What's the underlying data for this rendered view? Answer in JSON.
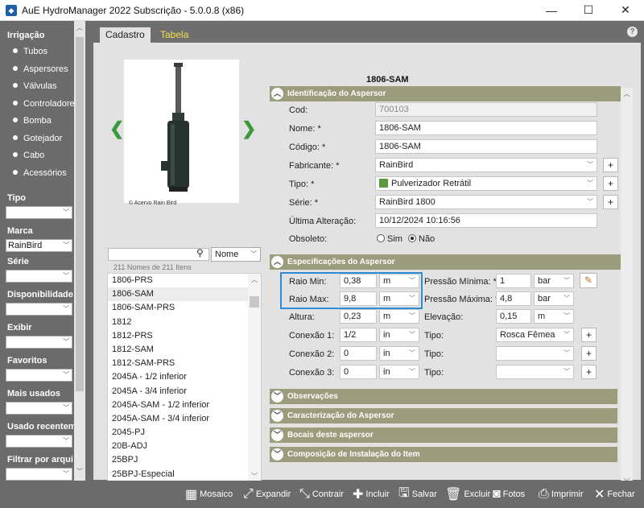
{
  "window": {
    "title": "AuE HydroManager 2022 Subscrição - 5.0.0.8 (x86)",
    "minimize": "—",
    "maximize": "☐",
    "close": "✕"
  },
  "sidebar": {
    "sections": [
      {
        "label": "Irrigação"
      },
      {
        "label": "Tipo",
        "value": ""
      },
      {
        "label": "Marca",
        "value": "RainBird"
      },
      {
        "label": "Série",
        "value": ""
      },
      {
        "label": "Disponibilidade",
        "value": ""
      },
      {
        "label": "Exibir",
        "value": ""
      },
      {
        "label": "Favoritos",
        "value": ""
      },
      {
        "label": "Mais usados",
        "value": ""
      },
      {
        "label": "Usado recentem",
        "value": ""
      },
      {
        "label": "Filtrar por arqui",
        "value": ""
      }
    ],
    "items": [
      "Tubos",
      "Aspersores",
      "Válvulas",
      "Controladores",
      "Bomba",
      "Gotejador",
      "Cabo",
      "Acessórios"
    ],
    "selected_item": "Aspersores"
  },
  "tabs": [
    {
      "label": "Cadastro",
      "active": true
    },
    {
      "label": "Tabela",
      "active": false
    }
  ],
  "photo": {
    "credit": "© Acervo Rain Bird"
  },
  "list": {
    "search_value": "",
    "order": "Nome",
    "count_text": "211 Nomes de 211 Itens",
    "items": [
      "1806-PRS",
      "1806-SAM",
      "1806-SAM-PRS",
      "1812",
      "1812-PRS",
      "1812-SAM",
      "1812-SAM-PRS",
      "2045A - 1/2 inferior",
      "2045A - 3/4 inferior",
      "2045A-SAM - 1/2 inferior",
      "2045A-SAM - 3/4 inferior",
      "2045-PJ",
      "20B-ADJ",
      "25BPJ",
      "25BPJ-Especial"
    ],
    "selected": "1806-SAM"
  },
  "form": {
    "title": "1806-SAM",
    "identificacao": {
      "header": "Identificação do Aspersor",
      "cod_label": "Cod:",
      "cod": "700103",
      "nome_label": "Nome: *",
      "nome": "1806-SAM",
      "codigo_label": "Código: *",
      "codigo": "1806-SAM",
      "fabricante_label": "Fabricante: *",
      "fabricante": "RainBird",
      "tipo_label": "Tipo: *",
      "tipo": "Pulverizador Retrátil",
      "serie_label": "Série: *",
      "serie": "RainBird 1800",
      "alteracao_label": "Última Alteração:",
      "alteracao": "10/12/2024 10:16:56",
      "obsoleto_label": "Obsoleto:",
      "sim": "Sim",
      "nao": "Não",
      "obsoleto_value": "Não"
    },
    "especificacoes": {
      "header": "Especificações do Aspersor",
      "raio_min_label": "Raio Min:",
      "raio_min": "0,38",
      "raio_min_unit": "m",
      "raio_max_label": "Raio Max:",
      "raio_max": "9,8",
      "raio_max_unit": "m",
      "altura_label": "Altura:",
      "altura": "0,23",
      "altura_unit": "m",
      "conexao1_label": "Conexão 1:",
      "conexao1": "1/2",
      "conexao1_unit": "in",
      "conexao2_label": "Conexão 2:",
      "conexao2": "0",
      "conexao2_unit": "in",
      "conexao3_label": "Conexão 3:",
      "conexao3": "0",
      "conexao3_unit": "in",
      "pressao_min_label": "Pressão Mínima: *",
      "pressao_min": "1",
      "pressao_min_unit": "bar",
      "pressao_max_label": "Pressão Máxima: *",
      "pressao_max": "4,8",
      "pressao_max_unit": "bar",
      "elevacao_label": "Elevação:",
      "elevacao": "0,15",
      "elevacao_unit": "m",
      "tipo1_label": "Tipo:",
      "tipo1": "Rosca Fêmea",
      "tipo2_label": "Tipo:",
      "tipo2": "",
      "tipo3_label": "Tipo:",
      "tipo3": ""
    },
    "collapsed_sections": [
      "Observações",
      "Caracterização do Aspersor",
      "Bocais deste aspersor",
      "Composição de Instalação do Item"
    ]
  },
  "toolbar": {
    "buttons": [
      {
        "label": "Mosaico",
        "icon": "mosaic-icon"
      },
      {
        "label": "Expandir",
        "icon": "expand-icon"
      },
      {
        "label": "Contrair",
        "icon": "collapse-icon"
      },
      {
        "label": "Incluir",
        "icon": "plus-icon"
      },
      {
        "label": "Salvar",
        "icon": "save-icon"
      },
      {
        "label": "Excluir",
        "icon": "trash-icon"
      },
      {
        "label": "Fotos",
        "icon": "camera-icon"
      },
      {
        "label": "Imprimir",
        "icon": "printer-icon"
      },
      {
        "label": "Fechar",
        "icon": "close-icon"
      }
    ]
  }
}
